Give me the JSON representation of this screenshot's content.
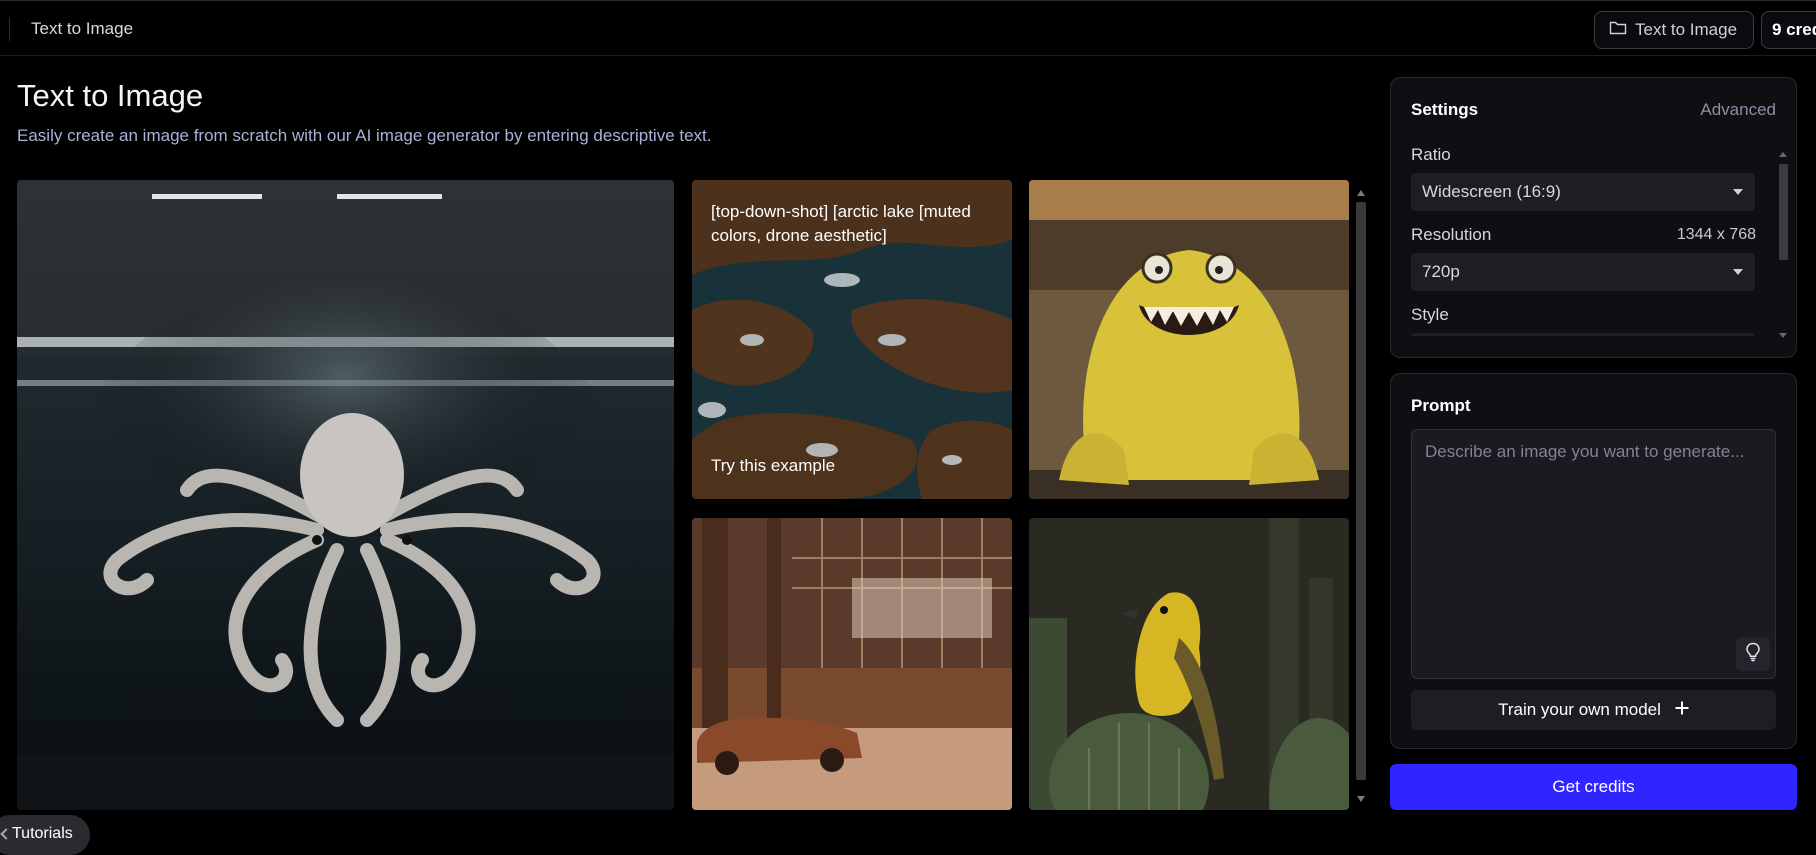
{
  "header": {
    "breadcrumb": "Text to Image",
    "folder_button": "Text to Image",
    "credits_button": "9 cred"
  },
  "page": {
    "title": "Text to Image",
    "subtitle": "Easily create an image from scratch with our AI image generator by entering descriptive text."
  },
  "gallery": {
    "example_prompt": "[top-down-shot] [arctic lake [muted colors, drone aesthetic]",
    "try_label": "Try this example"
  },
  "settings": {
    "title": "Settings",
    "advanced": "Advanced",
    "ratio_label": "Ratio",
    "ratio_value": "Widescreen (16:9)",
    "resolution_label": "Resolution",
    "resolution_dims": "1344 x 768",
    "resolution_value": "720p",
    "style_label": "Style"
  },
  "prompt": {
    "title": "Prompt",
    "placeholder": "Describe an image you want to generate...",
    "train_button": "Train your own model"
  },
  "get_credits": "Get credits",
  "tutorials": "Tutorials",
  "colors": {
    "accent": "#2f25ff",
    "panel_bg": "#0f0f13",
    "page_bg": "#000000"
  }
}
